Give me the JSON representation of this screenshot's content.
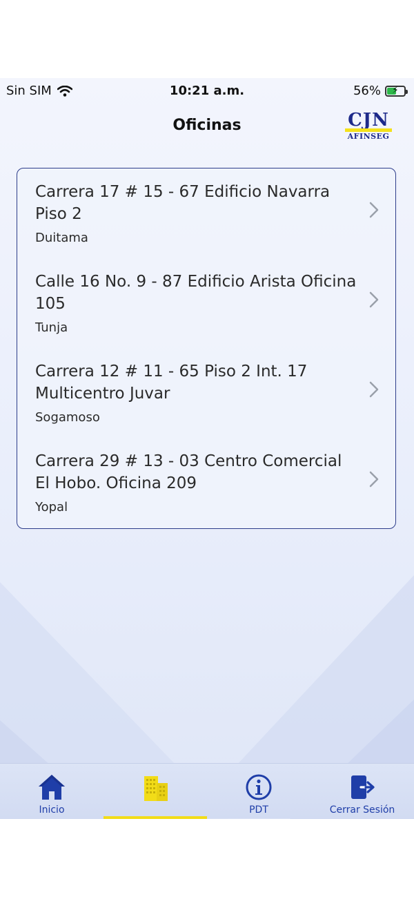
{
  "status_bar": {
    "carrier": "Sin SIM",
    "time": "10:21 a.m.",
    "battery": "56%",
    "battery_level": 0.56
  },
  "header": {
    "title": "Oficinas",
    "logo_text": "AFINSEG"
  },
  "offices": [
    {
      "address": "Carrera 17 # 15 - 67 Edificio Navarra Piso 2",
      "city": "Duitama"
    },
    {
      "address": "Calle 16 No. 9 - 87 Edificio Arista Oficina 105",
      "city": "Tunja"
    },
    {
      "address": "Carrera 12 # 11 - 65 Piso 2 Int. 17 Multicentro Juvar",
      "city": "Sogamoso"
    },
    {
      "address": "Carrera 29 # 13 - 03 Centro Comercial El Hobo. Oficina 209",
      "city": "Yopal"
    }
  ],
  "tabbar": {
    "tabs": [
      {
        "label": "Inicio",
        "icon": "home-icon"
      },
      {
        "label": "",
        "icon": "building-icon",
        "active": true
      },
      {
        "label": "PDT",
        "icon": "info-icon"
      },
      {
        "label": "Cerrar Sesión",
        "icon": "logout-icon"
      }
    ]
  },
  "colors": {
    "accent": "#1f3ea8",
    "highlight": "#f2dc18",
    "border": "#2c3c8a"
  }
}
